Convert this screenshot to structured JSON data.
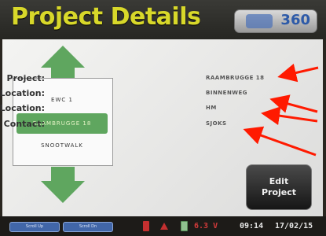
{
  "header": {
    "title": "Project Details",
    "logo_text": "360"
  },
  "project_list": {
    "items": [
      {
        "label": "EWC 1",
        "selected": false
      },
      {
        "label": "RAAMBRUGGE 18",
        "selected": true
      },
      {
        "label": "SNOOTWALK",
        "selected": false
      }
    ]
  },
  "details": {
    "project_label": "Project:",
    "project_value": "RAAMBRUGGE 18",
    "location1_label": "Location:",
    "location1_value": "BINNENWEG",
    "location2_label": "Location:",
    "location2_value": "HM",
    "contact_label": "Contact:",
    "contact_value": "SJOKS"
  },
  "edit_button": {
    "line1": "Edit",
    "line2": "Project"
  },
  "footer": {
    "btn1": "Scroll Up",
    "btn2": "Scroll Dn",
    "voltage": "6.3 V",
    "time": "09:14",
    "date": "17/02/15"
  },
  "colors": {
    "title": "#d8d82a",
    "arrow": "#5fa65f",
    "selected": "#5fa65f",
    "annotation": "#ff1a00",
    "voltage": "#d23a3a"
  }
}
